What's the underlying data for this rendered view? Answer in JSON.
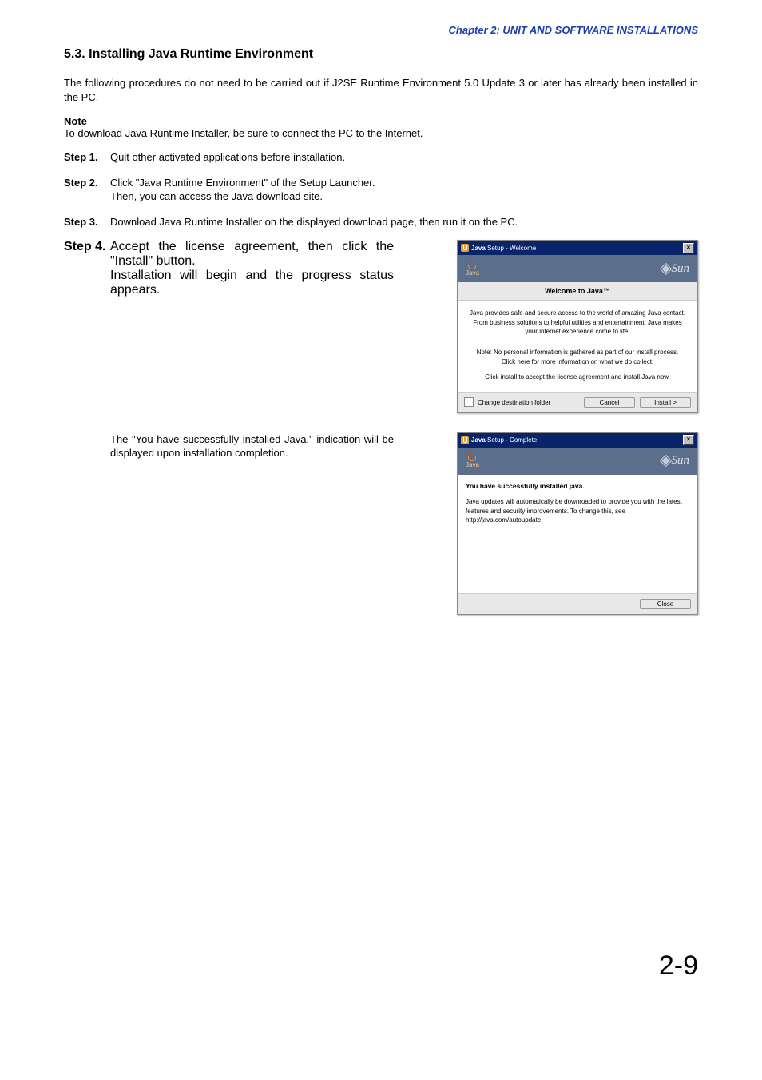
{
  "chapter": "Chapter 2:  UNIT AND SOFTWARE INSTALLATIONS",
  "section_title": "5.3. Installing Java Runtime Environment",
  "intro": "The following procedures do not need to be carried out if J2SE Runtime Environment 5.0 Update 3 or later has already been installed in the PC.",
  "note_label": "Note",
  "note_text": "To download Java Runtime Installer, be sure to connect the PC to the Internet.",
  "steps": {
    "s1_label": "Step 1.",
    "s1": "Quit other activated applications before installation.",
    "s2_label": "Step 2.",
    "s2a": "Click \"Java Runtime Environment\" of the Setup Launcher.",
    "s2b": "Then, you can access the Java download site.",
    "s3_label": "Step 3.",
    "s3": "Download Java Runtime Installer on the displayed download page, then run it on the PC.",
    "s4_label": "Step 4.",
    "s4a": "Accept the license agreement, then click the \"Install\" button.",
    "s4b": "Installation will begin and the progress status appears.",
    "s4c": "The \"You have successfully installed Java.\" indication will be displayed upon installation completion."
  },
  "dlg1": {
    "title_prefix": "Java",
    "title_rest": " Setup - Welcome",
    "logo_text": "Java",
    "sun": "Sun",
    "heading": "Welcome to Java™",
    "p1": "Java provides safe and secure access to the world of amazing Java contact. From business solutions to helpful utilities and entertainment, Java makes your internet experience come to life.",
    "p2a": "Note: No personal information is gathered as part of our install process.",
    "p2b": "Click here for more information on what we do collect.",
    "p3": "Click install to accept the license agreement and install Java now.",
    "check_label": "Change destination folder",
    "cancel": "Cancel",
    "install": "Install >",
    "close_x": "×"
  },
  "dlg2": {
    "title_prefix": "Java",
    "title_rest": " Setup - Complete",
    "logo_text": "Java",
    "sun": "Sun",
    "success": "You have successfully installed java.",
    "body": "Java updates will automatically be downroaded to provide you with the latest features and security improvements. To change this, see http://java.com/autoupdate",
    "close": "Close",
    "close_x": "×"
  },
  "page_number": "2-9"
}
